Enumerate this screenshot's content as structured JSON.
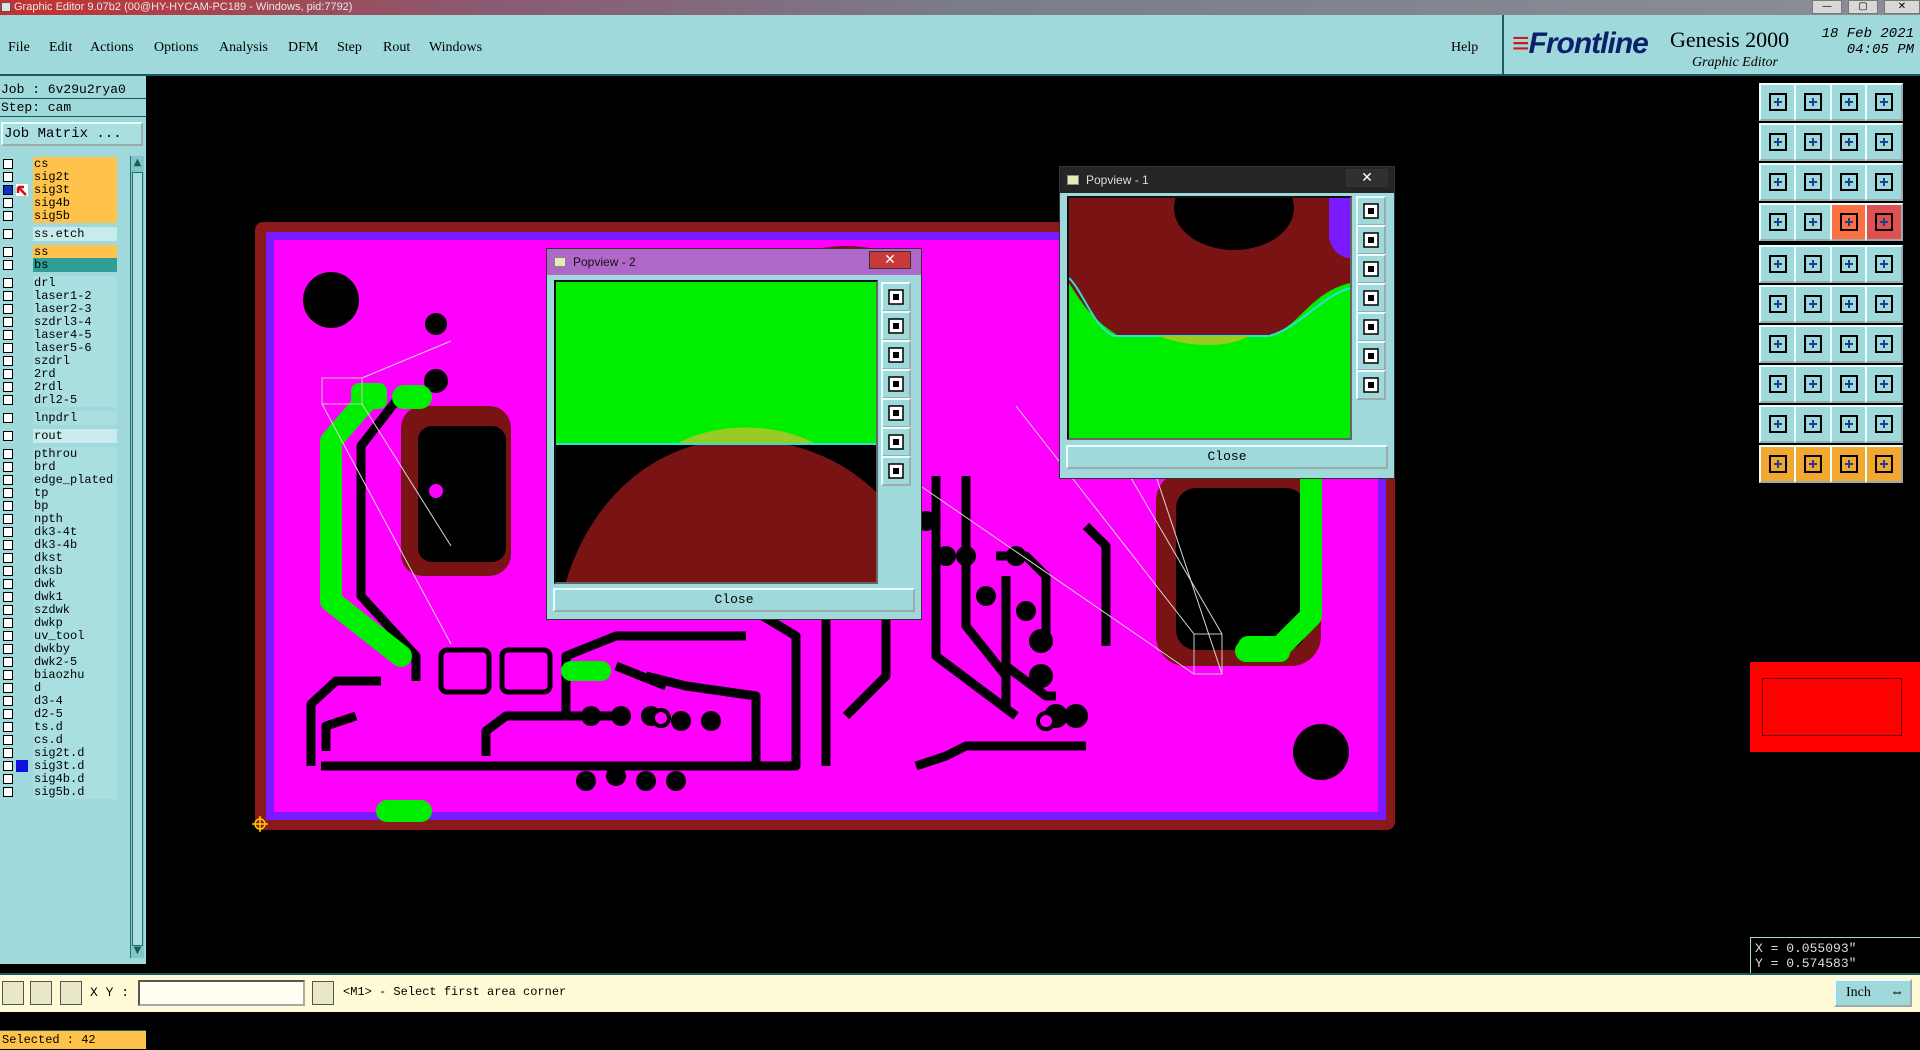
{
  "window": {
    "title": "Graphic Editor 9.07b2 (00@HY-HYCAM-PC189 - Windows, pid:7792)",
    "minimize": "—",
    "maximize": "▢",
    "close": "✕"
  },
  "menu": {
    "items": [
      "File",
      "Edit",
      "Actions",
      "Options",
      "Analysis",
      "DFM",
      "Step",
      "Rout",
      "Windows"
    ],
    "help": "Help"
  },
  "logo": {
    "brand": "Frontline",
    "product": "Genesis 2000",
    "subtitle": "Graphic Editor",
    "date": "18 Feb 2021",
    "time": "04:05 PM"
  },
  "job": {
    "job_line": "Job : 6v29u2rya0",
    "step_line": "Step: cam",
    "matrix_button": "Job Matrix ..."
  },
  "layers": [
    {
      "name": "cs",
      "color": "#ffc24a",
      "group": 0
    },
    {
      "name": "sig2t",
      "color": "#ffc24a",
      "group": 0
    },
    {
      "name": "sig3t",
      "color": "#ffc24a",
      "group": 0,
      "active": true
    },
    {
      "name": "sig4b",
      "color": "#ffc24a",
      "group": 0
    },
    {
      "name": "sig5b",
      "color": "#ffc24a",
      "group": 0
    },
    {
      "name": "ss.etch",
      "color": "#c8ecee",
      "group": 1
    },
    {
      "name": "ss",
      "color": "#ffc24a",
      "group": 2
    },
    {
      "name": "bs",
      "color": "#2f9f96",
      "group": 2
    },
    {
      "name": "drl",
      "color": "#a9dfe0",
      "group": 3
    },
    {
      "name": "laser1-2",
      "color": "#a9dfe0",
      "group": 3
    },
    {
      "name": "laser2-3",
      "color": "#a9dfe0",
      "group": 3
    },
    {
      "name": "szdrl3-4",
      "color": "#a9dfe0",
      "group": 3
    },
    {
      "name": "laser4-5",
      "color": "#a9dfe0",
      "group": 3
    },
    {
      "name": "laser5-6",
      "color": "#a9dfe0",
      "group": 3
    },
    {
      "name": "szdrl",
      "color": "#a9dfe0",
      "group": 3
    },
    {
      "name": "2rd",
      "color": "#a9dfe0",
      "group": 3
    },
    {
      "name": "2rdl",
      "color": "#a9dfe0",
      "group": 3
    },
    {
      "name": "drl2-5",
      "color": "#a9dfe0",
      "group": 3
    },
    {
      "name": "lnpdrl",
      "color": "#a9dfe0",
      "group": 4
    },
    {
      "name": "rout",
      "color": "#c8ecee",
      "group": 5
    },
    {
      "name": "pthrou",
      "color": "#a9dfe0",
      "group": 6
    },
    {
      "name": "brd",
      "color": "#a9dfe0",
      "group": 6
    },
    {
      "name": "edge_plated",
      "color": "#a9dfe0",
      "group": 6
    },
    {
      "name": "tp",
      "color": "#a9dfe0",
      "group": 6
    },
    {
      "name": "bp",
      "color": "#a9dfe0",
      "group": 6
    },
    {
      "name": "npth",
      "color": "#a9dfe0",
      "group": 6
    },
    {
      "name": "dk3-4t",
      "color": "#a9dfe0",
      "group": 6
    },
    {
      "name": "dk3-4b",
      "color": "#a9dfe0",
      "group": 6
    },
    {
      "name": "dkst",
      "color": "#a9dfe0",
      "group": 6
    },
    {
      "name": "dksb",
      "color": "#a9dfe0",
      "group": 6
    },
    {
      "name": "dwk",
      "color": "#a9dfe0",
      "group": 6
    },
    {
      "name": "dwk1",
      "color": "#a9dfe0",
      "group": 6
    },
    {
      "name": "szdwk",
      "color": "#a9dfe0",
      "group": 6
    },
    {
      "name": "dwkp",
      "color": "#a9dfe0",
      "group": 6
    },
    {
      "name": "uv_tool",
      "color": "#a9dfe0",
      "group": 6
    },
    {
      "name": "dwkby",
      "color": "#a9dfe0",
      "group": 6
    },
    {
      "name": "dwk2-5",
      "color": "#a9dfe0",
      "group": 6
    },
    {
      "name": "biaozhu",
      "color": "#a9dfe0",
      "group": 6
    },
    {
      "name": "d",
      "color": "#a9dfe0",
      "group": 6
    },
    {
      "name": "d3-4",
      "color": "#a9dfe0",
      "group": 6
    },
    {
      "name": "d2-5",
      "color": "#a9dfe0",
      "group": 6
    },
    {
      "name": "ts.d",
      "color": "#a9dfe0",
      "group": 6
    },
    {
      "name": "cs.d",
      "color": "#a9dfe0",
      "group": 6
    },
    {
      "name": "sig2t.d",
      "color": "#a9dfe0",
      "group": 6
    },
    {
      "name": "sig3t.d",
      "color": "#a9dfe0",
      "group": 6,
      "marked": true
    },
    {
      "name": "sig4b.d",
      "color": "#a9dfe0",
      "group": 6
    },
    {
      "name": "sig5b.d",
      "color": "#a9dfe0",
      "group": 6
    }
  ],
  "selected": "Selected : 42",
  "popups": [
    {
      "title": "Popview - 2",
      "close_label": "Close"
    },
    {
      "title": "Popview - 1",
      "close_label": "Close"
    }
  ],
  "coords": {
    "x": "X = 0.055093\"",
    "y": "Y = 0.574583\""
  },
  "status": {
    "xy_label": "X Y :",
    "xy_value": "",
    "message": "<M1> - Select first area corner",
    "unit": "Inch"
  },
  "colors": {
    "board_magenta": "#ff00ff",
    "board_border": "#8a1a1a",
    "outline_purple": "#7a1aff",
    "copper_green": "#00ee00",
    "dark_red": "#7a1414",
    "panel_cyan": "#9fd9db",
    "highlight_orange": "#ffc24a"
  }
}
